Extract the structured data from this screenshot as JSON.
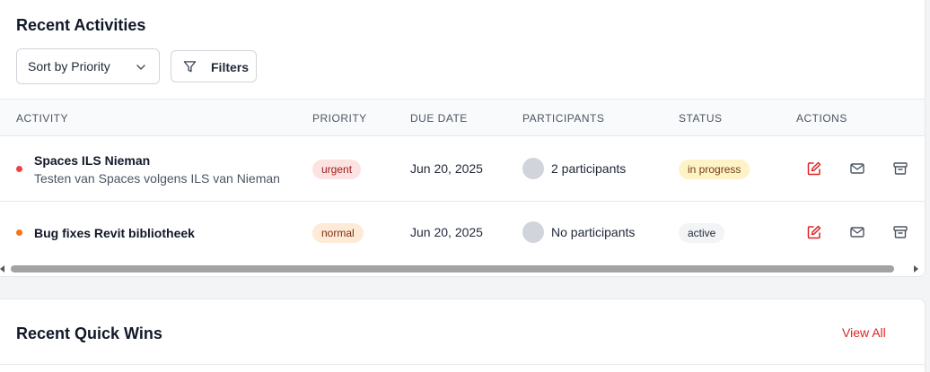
{
  "activities_section": {
    "title": "Recent Activities",
    "sort": {
      "selected": "Sort by Priority"
    },
    "filters_label": "Filters",
    "columns": [
      "ACTIVITY",
      "PRIORITY",
      "DUE DATE",
      "PARTICIPANTS",
      "STATUS",
      "ACTIONS"
    ],
    "rows": [
      {
        "title": "Spaces ILS Nieman",
        "subtitle": "Testen van Spaces volgens ILS van Nieman",
        "dot_color": "#ef4444",
        "priority": "urgent",
        "due_date": "Jun 20, 2025",
        "participants": "2 participants",
        "status": "in progress"
      },
      {
        "title": "Bug fixes Revit bibliotheek",
        "subtitle": "",
        "dot_color": "#f97316",
        "priority": "normal",
        "due_date": "Jun 20, 2025",
        "participants": "No participants",
        "status": "active"
      }
    ],
    "action_icons": [
      "edit-icon",
      "mail-icon",
      "archive-icon"
    ]
  },
  "quick_wins_section": {
    "title": "Recent Quick Wins",
    "view_all_label": "View All"
  },
  "colors": {
    "accent_red": "#dc2626",
    "urgent_dot": "#ef4444",
    "normal_dot": "#f97316"
  }
}
